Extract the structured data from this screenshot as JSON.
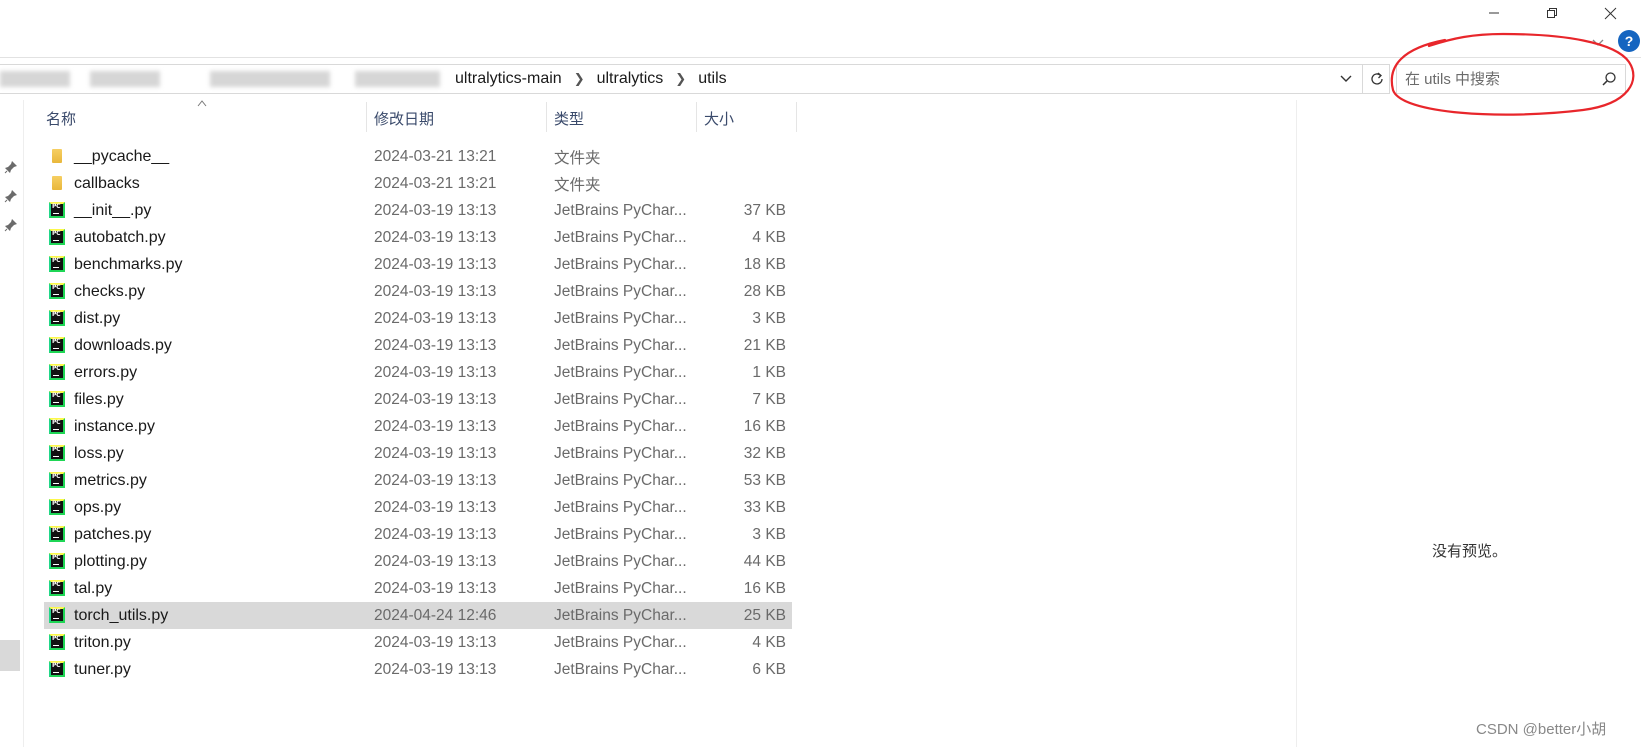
{
  "window": {
    "controls": {
      "minimize": "minimize-icon",
      "maximize": "restore-icon",
      "close": "close-icon"
    }
  },
  "ribbon": {
    "collapse_icon": "chevron-down-icon",
    "help_label": "?"
  },
  "address_bar": {
    "breadcrumbs": [
      "ultralytics-main",
      "ultralytics",
      "utils"
    ],
    "separator_icon": "chevron-right-icon",
    "dropdown_icon": "chevron-down-icon",
    "refresh_icon": "refresh-icon"
  },
  "search": {
    "placeholder": "在 utils 中搜索",
    "value": "",
    "icon": "search-icon"
  },
  "nav": {
    "pin_icon": "pin-icon"
  },
  "columns": {
    "name": "名称",
    "date": "修改日期",
    "type": "类型",
    "size": "大小"
  },
  "files": [
    {
      "name": "__pycache__",
      "date": "2024-03-21 13:21",
      "type": "文件夹",
      "size": "",
      "kind": "folder"
    },
    {
      "name": "callbacks",
      "date": "2024-03-21 13:21",
      "type": "文件夹",
      "size": "",
      "kind": "folder"
    },
    {
      "name": "__init__.py",
      "date": "2024-03-19 13:13",
      "type": "JetBrains PyChar...",
      "size": "37 KB",
      "kind": "py"
    },
    {
      "name": "autobatch.py",
      "date": "2024-03-19 13:13",
      "type": "JetBrains PyChar...",
      "size": "4 KB",
      "kind": "py"
    },
    {
      "name": "benchmarks.py",
      "date": "2024-03-19 13:13",
      "type": "JetBrains PyChar...",
      "size": "18 KB",
      "kind": "py"
    },
    {
      "name": "checks.py",
      "date": "2024-03-19 13:13",
      "type": "JetBrains PyChar...",
      "size": "28 KB",
      "kind": "py"
    },
    {
      "name": "dist.py",
      "date": "2024-03-19 13:13",
      "type": "JetBrains PyChar...",
      "size": "3 KB",
      "kind": "py"
    },
    {
      "name": "downloads.py",
      "date": "2024-03-19 13:13",
      "type": "JetBrains PyChar...",
      "size": "21 KB",
      "kind": "py"
    },
    {
      "name": "errors.py",
      "date": "2024-03-19 13:13",
      "type": "JetBrains PyChar...",
      "size": "1 KB",
      "kind": "py"
    },
    {
      "name": "files.py",
      "date": "2024-03-19 13:13",
      "type": "JetBrains PyChar...",
      "size": "7 KB",
      "kind": "py"
    },
    {
      "name": "instance.py",
      "date": "2024-03-19 13:13",
      "type": "JetBrains PyChar...",
      "size": "16 KB",
      "kind": "py"
    },
    {
      "name": "loss.py",
      "date": "2024-03-19 13:13",
      "type": "JetBrains PyChar...",
      "size": "32 KB",
      "kind": "py"
    },
    {
      "name": "metrics.py",
      "date": "2024-03-19 13:13",
      "type": "JetBrains PyChar...",
      "size": "53 KB",
      "kind": "py"
    },
    {
      "name": "ops.py",
      "date": "2024-03-19 13:13",
      "type": "JetBrains PyChar...",
      "size": "33 KB",
      "kind": "py"
    },
    {
      "name": "patches.py",
      "date": "2024-03-19 13:13",
      "type": "JetBrains PyChar...",
      "size": "3 KB",
      "kind": "py"
    },
    {
      "name": "plotting.py",
      "date": "2024-03-19 13:13",
      "type": "JetBrains PyChar...",
      "size": "44 KB",
      "kind": "py"
    },
    {
      "name": "tal.py",
      "date": "2024-03-19 13:13",
      "type": "JetBrains PyChar...",
      "size": "16 KB",
      "kind": "py"
    },
    {
      "name": "torch_utils.py",
      "date": "2024-04-24 12:46",
      "type": "JetBrains PyChar...",
      "size": "25 KB",
      "kind": "py",
      "selected": true
    },
    {
      "name": "triton.py",
      "date": "2024-03-19 13:13",
      "type": "JetBrains PyChar...",
      "size": "4 KB",
      "kind": "py"
    },
    {
      "name": "tuner.py",
      "date": "2024-03-19 13:13",
      "type": "JetBrains PyChar...",
      "size": "6 KB",
      "kind": "py"
    }
  ],
  "preview": {
    "empty_text": "没有预览。"
  },
  "watermark": "CSDN @better小胡",
  "colors": {
    "annotation": "#e8262b",
    "selection": "#d9d9d9",
    "help": "#1565c0",
    "header_text": "#3a4a6b"
  }
}
